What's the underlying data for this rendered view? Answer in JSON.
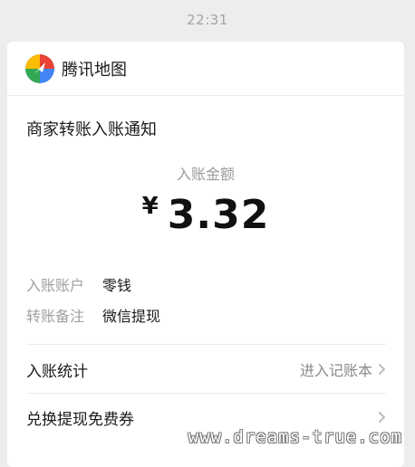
{
  "timestamp": "22:31",
  "app": {
    "name": "腾讯地图",
    "logo_icon": "tencent-map-logo-icon"
  },
  "notice": {
    "title": "商家转账入账通知",
    "amount_label": "入账金额",
    "currency": "¥",
    "amount": "3.32"
  },
  "details": [
    {
      "key": "入账账户",
      "value": "零钱"
    },
    {
      "key": "转账备注",
      "value": "微信提现"
    }
  ],
  "actions": {
    "stats_label": "入账统计",
    "stats_link": "进入记账本",
    "coupon_label": "兑换提现免费券"
  },
  "watermark": "www.dreams-true.com",
  "colors": {
    "background": "#ededed",
    "card": "#ffffff",
    "secondary_text": "#a0a0a0"
  }
}
